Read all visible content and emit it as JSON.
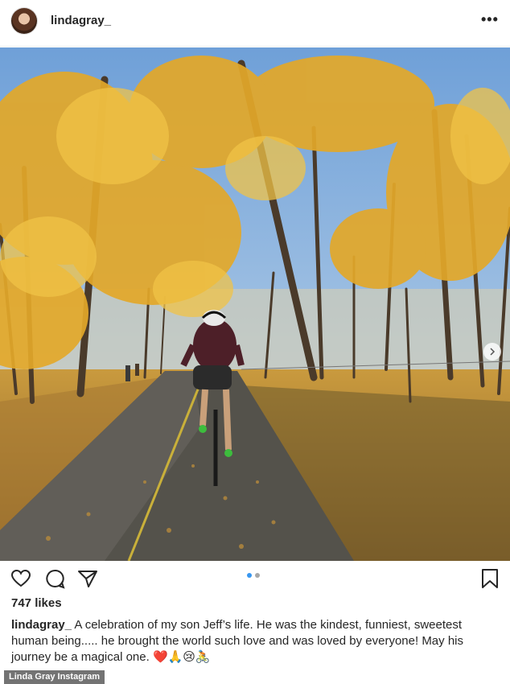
{
  "post": {
    "username": "lindagray_",
    "more_icon": "more-horizontal-icon",
    "likes": "747 likes",
    "caption_username": "lindagray_",
    "caption_text": "A celebration of my son Jeff’s life. He was the kindest, funniest, sweetest human being..... he brought the world such love and was loved by everyone! May his journey be a magical one. ❤️🙏😢🚴",
    "carousel": {
      "current": 1,
      "total": 2
    }
  },
  "icons": [
    "heart-icon",
    "comment-icon",
    "share-icon",
    "bookmark-icon",
    "chevron-right-icon"
  ],
  "colors": {
    "accent": "#3897f0",
    "text": "#262626",
    "border": "#efefef"
  },
  "credit": "Linda Gray Instagram"
}
